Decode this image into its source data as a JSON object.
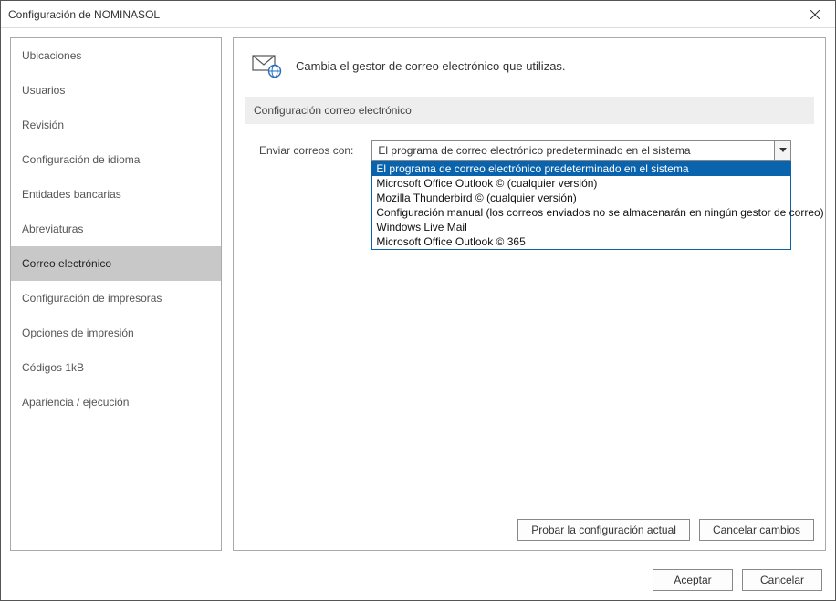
{
  "window": {
    "title": "Configuración de NOMINASOL"
  },
  "sidebar": {
    "items": [
      {
        "label": "Ubicaciones"
      },
      {
        "label": "Usuarios"
      },
      {
        "label": "Revisión"
      },
      {
        "label": "Configuración de idioma"
      },
      {
        "label": "Entidades bancarias"
      },
      {
        "label": "Abreviaturas"
      },
      {
        "label": "Correo electrónico"
      },
      {
        "label": "Configuración de impresoras"
      },
      {
        "label": "Opciones de impresión"
      },
      {
        "label": "Códigos 1kB"
      },
      {
        "label": "Apariencia / ejecución"
      }
    ],
    "selected_index": 6
  },
  "content": {
    "header_desc": "Cambia el gestor de correo electrónico que utilizas.",
    "section_title": "Configuración correo electrónico",
    "field_label": "Enviar correos con:",
    "selected_value": "El programa de correo electrónico predeterminado en el sistema",
    "options": [
      "El programa de correo electrónico predeterminado en el sistema",
      "Microsoft Office Outlook © (cualquier versión)",
      "Mozilla Thunderbird © (cualquier versión)",
      "Configuración manual (los correos enviados no se almacenarán en ningún gestor de correo)",
      "Windows Live Mail",
      "Microsoft Office Outlook © 365"
    ],
    "highlight_index": 0,
    "test_button": "Probar la configuración actual",
    "cancel_changes_button": "Cancelar cambios"
  },
  "footer": {
    "accept": "Aceptar",
    "cancel": "Cancelar"
  }
}
